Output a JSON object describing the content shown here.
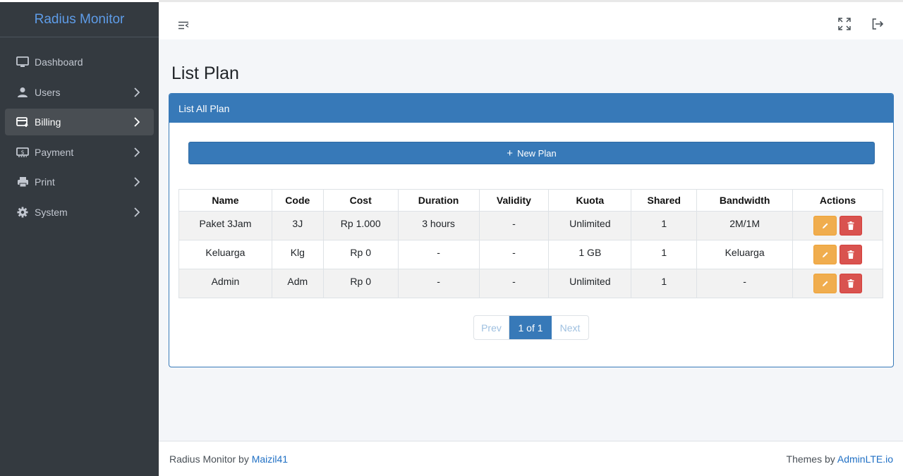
{
  "brand": {
    "title": "Radius Monitor"
  },
  "sidebar": {
    "items": [
      {
        "label": "Dashboard",
        "icon": "monitor-icon"
      },
      {
        "label": "Users",
        "icon": "user-icon"
      },
      {
        "label": "Billing",
        "icon": "billing-card-icon",
        "active": true
      },
      {
        "label": "Payment",
        "icon": "money-icon"
      },
      {
        "label": "Print",
        "icon": "printer-icon"
      },
      {
        "label": "System",
        "icon": "gear-icon"
      }
    ]
  },
  "page": {
    "title": "List Plan"
  },
  "card": {
    "header": "List All Plan",
    "new_button": "New Plan"
  },
  "table": {
    "columns": [
      "Name",
      "Code",
      "Cost",
      "Duration",
      "Validity",
      "Kuota",
      "Shared",
      "Bandwidth",
      "Actions"
    ],
    "rows": [
      {
        "name": "Paket 3Jam",
        "code": "3J",
        "cost": "Rp 1.000",
        "duration": "3 hours",
        "validity": "-",
        "kuota": "Unlimited",
        "shared": "1",
        "bandwidth": "2M/1M"
      },
      {
        "name": "Keluarga",
        "code": "Klg",
        "cost": "Rp 0",
        "duration": "-",
        "validity": "-",
        "kuota": "1 GB",
        "shared": "1",
        "bandwidth": "Keluarga"
      },
      {
        "name": "Admin",
        "code": "Adm",
        "cost": "Rp 0",
        "duration": "-",
        "validity": "-",
        "kuota": "Unlimited",
        "shared": "1",
        "bandwidth": "-"
      }
    ]
  },
  "pagination": {
    "prev": "Prev",
    "current": "1 of 1",
    "next": "Next"
  },
  "footer": {
    "left_text": "Radius Monitor by ",
    "left_link": "Maizil41",
    "right_text": "Themes by ",
    "right_link": "AdminLTE.io"
  },
  "colors": {
    "sidebar": "#343a40",
    "primary": "#3779b8",
    "warning": "#f0ad4e",
    "danger": "#d9534f",
    "brand": "#5e9ce8"
  }
}
